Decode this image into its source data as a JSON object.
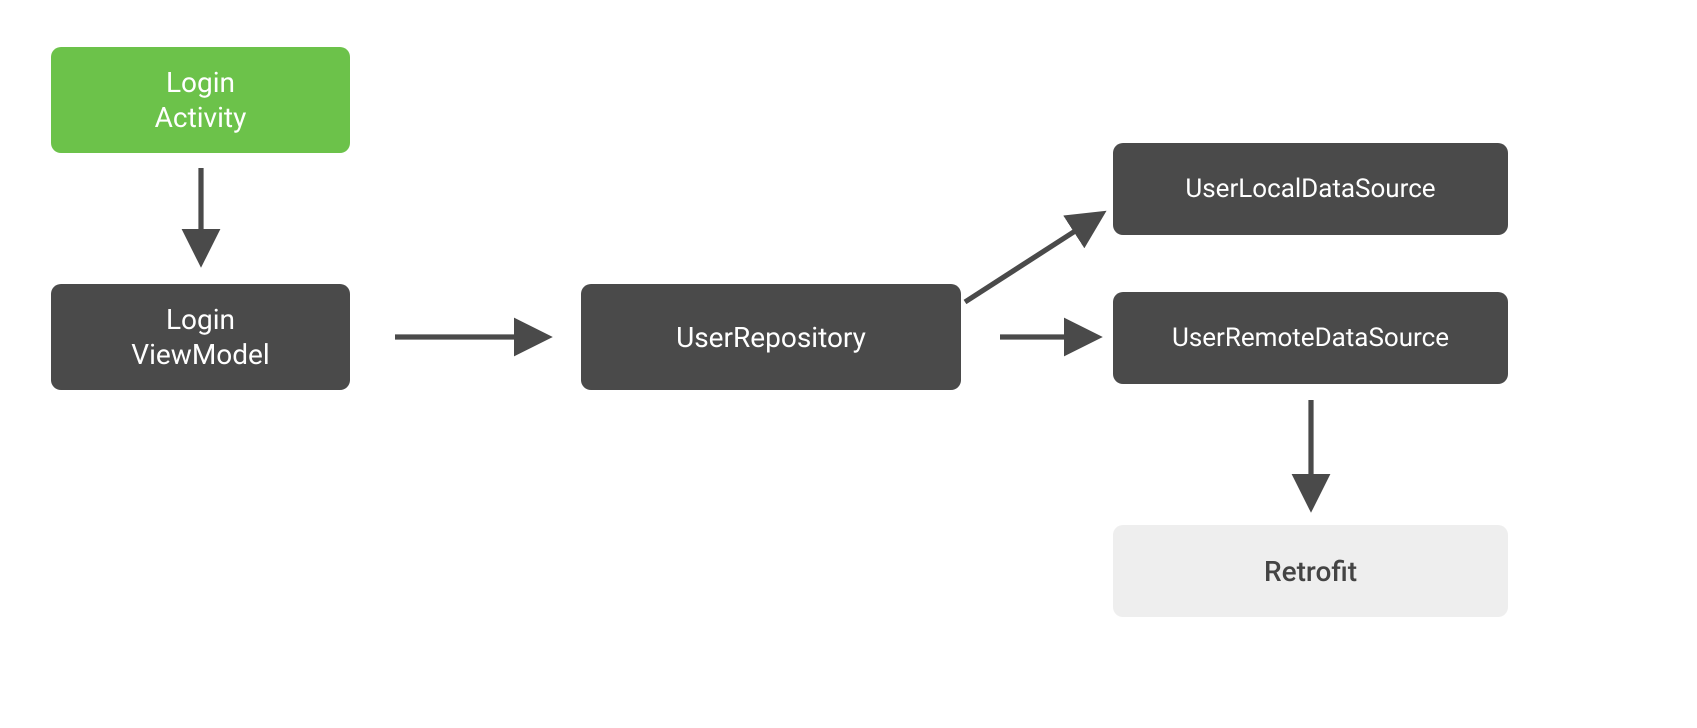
{
  "nodes": {
    "login_activity": {
      "label": "Login\nActivity"
    },
    "login_viewmodel": {
      "label": "Login\nViewModel"
    },
    "user_repository": {
      "label": "UserRepository"
    },
    "user_local_ds": {
      "label": "UserLocalDataSource"
    },
    "user_remote_ds": {
      "label": "UserRemoteDataSource"
    },
    "retrofit": {
      "label": "Retrofit"
    }
  },
  "colors": {
    "green": "#6cc24a",
    "dark": "#4a4a4a",
    "light": "#eeeeee",
    "arrow": "#4a4a4a"
  },
  "edges": [
    {
      "from": "login_activity",
      "to": "login_viewmodel"
    },
    {
      "from": "login_viewmodel",
      "to": "user_repository"
    },
    {
      "from": "user_repository",
      "to": "user_local_ds"
    },
    {
      "from": "user_repository",
      "to": "user_remote_ds"
    },
    {
      "from": "user_remote_ds",
      "to": "retrofit"
    }
  ]
}
